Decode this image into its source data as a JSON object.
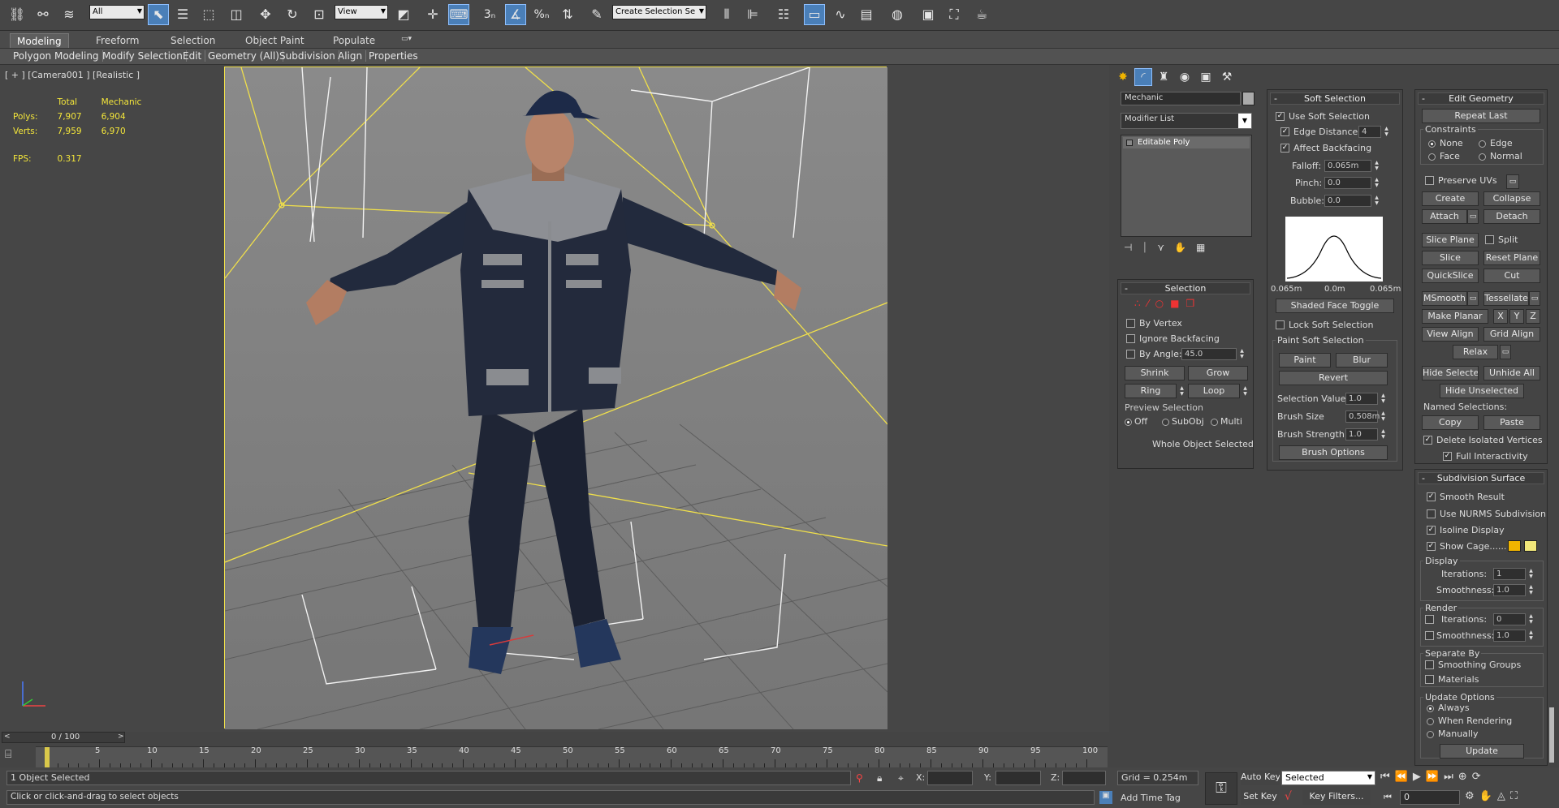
{
  "toolbar": {
    "selection_filter": "All",
    "ref_coord": "View",
    "named_selection_placeholder": "Create Selection Se",
    "snap_angle_label": "3",
    "percent_label": "%"
  },
  "ribbon": {
    "tabs": [
      "Modeling",
      "Freeform",
      "Selection",
      "Object Paint",
      "Populate"
    ],
    "sub_items": [
      "Polygon Modeling",
      "Modify Selection",
      "Edit",
      "Geometry (All)",
      "Subdivision",
      "Align",
      "Properties"
    ]
  },
  "viewport": {
    "label": "[ + ] [Camera001 ] [Realistic ]",
    "stats": {
      "headers": [
        "Total",
        "Mechanic"
      ],
      "polys_label": "Polys:",
      "polys_total": "7,907",
      "polys_obj": "6,904",
      "verts_label": "Verts:",
      "verts_total": "7,959",
      "verts_obj": "6,970",
      "fps_label": "FPS:",
      "fps_value": "0.317"
    }
  },
  "command_panel": {
    "object_name": "Mechanic",
    "modifier_list": "Modifier List",
    "stack_item": "Editable Poly",
    "selection": {
      "title": "Selection",
      "by_vertex": "By Vertex",
      "ignore_backfacing": "Ignore Backfacing",
      "by_angle": "By Angle:",
      "by_angle_value": "45.0",
      "shrink": "Shrink",
      "grow": "Grow",
      "ring": "Ring",
      "loop": "Loop",
      "preview_selection": "Preview Selection",
      "preview_off": "Off",
      "preview_subobj": "SubObj",
      "preview_multi": "Multi",
      "status": "Whole Object Selected"
    }
  },
  "soft_selection": {
    "title": "Soft Selection",
    "use_soft": "Use Soft Selection",
    "edge_distance": "Edge Distance:",
    "edge_distance_value": "4",
    "affect_backfacing": "Affect Backfacing",
    "falloff": "Falloff:",
    "falloff_value": "0.065m",
    "pinch": "Pinch:",
    "pinch_value": "0.0",
    "bubble": "Bubble:",
    "bubble_value": "0.0",
    "curve_labels": [
      "0.065m",
      "0.0m",
      "0.065m"
    ],
    "shaded_face_toggle": "Shaded Face Toggle",
    "lock_soft": "Lock Soft Selection",
    "paint_group": "Paint Soft Selection",
    "paint": "Paint",
    "blur": "Blur",
    "revert": "Revert",
    "selection_value": "Selection Value",
    "selection_value_v": "1.0",
    "brush_size": "Brush Size",
    "brush_size_v": "0.508m",
    "brush_strength": "Brush Strength",
    "brush_strength_v": "1.0",
    "brush_options": "Brush Options"
  },
  "edit_geometry": {
    "title": "Edit Geometry",
    "repeat_last": "Repeat Last",
    "constraints": "Constraints",
    "none": "None",
    "edge": "Edge",
    "face": "Face",
    "normal": "Normal",
    "preserve_uvs": "Preserve UVs",
    "create": "Create",
    "collapse": "Collapse",
    "attach": "Attach",
    "detach": "Detach",
    "slice_plane": "Slice Plane",
    "split": "Split",
    "slice": "Slice",
    "reset_plane": "Reset Plane",
    "quickslice": "QuickSlice",
    "cut": "Cut",
    "msmooth": "MSmooth",
    "tessellate": "Tessellate",
    "make_planar": "Make Planar",
    "x": "X",
    "y": "Y",
    "z": "Z",
    "view_align": "View Align",
    "grid_align": "Grid Align",
    "relax": "Relax",
    "hide_selected": "Hide Selected",
    "unhide_all": "Unhide All",
    "hide_unselected": "Hide Unselected",
    "named_selections": "Named Selections:",
    "copy": "Copy",
    "paste": "Paste",
    "delete_isolated": "Delete Isolated Vertices",
    "full_interactivity": "Full Interactivity"
  },
  "subdivision_surface": {
    "title": "Subdivision Surface",
    "smooth_result": "Smooth Result",
    "use_nurms": "Use NURMS Subdivision",
    "isoline": "Isoline Display",
    "show_cage": "Show Cage......",
    "display": "Display",
    "iterations": "Iterations:",
    "iterations_value": "1",
    "smoothness": "Smoothness:",
    "smoothness_value": "1.0",
    "render": "Render",
    "r_iterations_value": "0",
    "r_smoothness_value": "1.0",
    "separate_by": "Separate By",
    "smoothing_groups": "Smoothing Groups",
    "materials": "Materials",
    "update_options": "Update Options",
    "always": "Always",
    "when_rendering": "When Rendering",
    "manually": "Manually",
    "update": "Update",
    "cage_colors": [
      "#f0b400",
      "#f1e77a"
    ]
  },
  "timeline": {
    "frame": "0 / 100",
    "ticks": [
      "5",
      "10",
      "15",
      "20",
      "25",
      "30",
      "35",
      "40",
      "45",
      "50",
      "55",
      "60",
      "65",
      "70",
      "75",
      "80",
      "85",
      "90",
      "95",
      "100"
    ]
  },
  "status": {
    "selected": "1 Object Selected",
    "prompt": "Click or click-and-drag to select objects",
    "x_label": "X:",
    "y_label": "Y:",
    "z_label": "Z:",
    "grid": "Grid = 0.254m",
    "add_time_tag": "Add Time Tag",
    "auto_key": "Auto Key",
    "set_key": "Set Key",
    "key_mode": "Selected",
    "key_filters": "Key Filters...",
    "frame_value": "0"
  }
}
